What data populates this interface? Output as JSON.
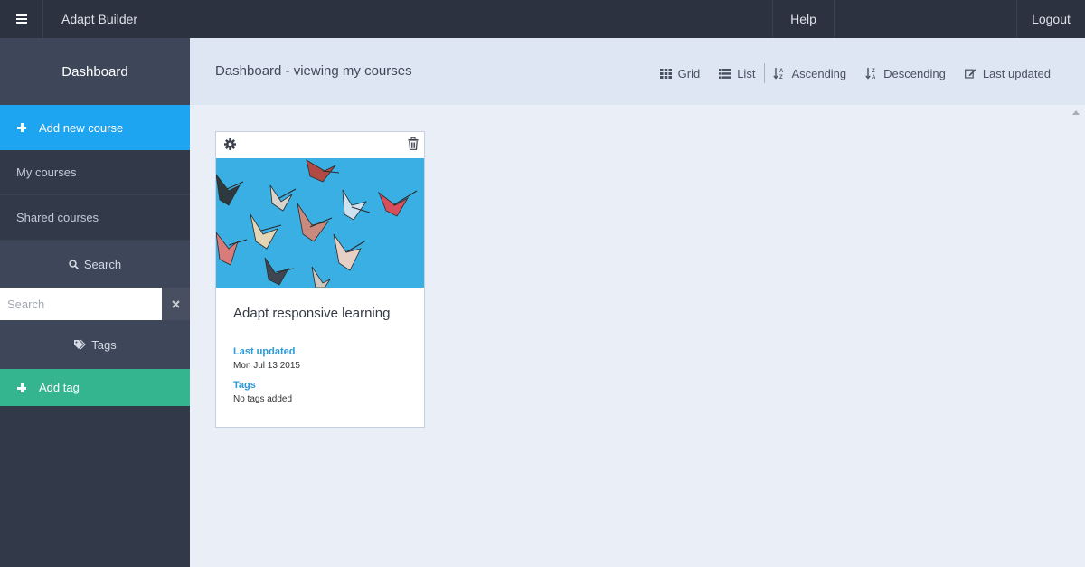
{
  "topbar": {
    "menu_icon": "hamburger-icon",
    "app_title": "Adapt Builder",
    "help_label": "Help",
    "logout_label": "Logout"
  },
  "sidebar": {
    "header": "Dashboard",
    "add_course_label": "Add new course",
    "items": [
      {
        "label": "My courses"
      },
      {
        "label": "Shared courses"
      }
    ],
    "search_section_label": "Search",
    "search_placeholder": "Search",
    "search_value": "",
    "clear_icon": "close-icon",
    "tags_section_label": "Tags",
    "add_tag_label": "Add tag"
  },
  "main": {
    "title": "Dashboard - viewing my courses",
    "toolbar": {
      "grid_label": "Grid",
      "list_label": "List",
      "ascending_label": "Ascending",
      "descending_label": "Descending",
      "last_updated_label": "Last updated"
    }
  },
  "courses": [
    {
      "title": "Adapt responsive learning",
      "last_updated_label": "Last updated",
      "last_updated_value": "Mon Jul 13 2015",
      "tags_label": "Tags",
      "tags_value": "No tags added",
      "image": "origami-paper-cranes-on-blue"
    }
  ],
  "colors": {
    "topbar": "#2d3241",
    "sidebar": "#323a4a",
    "add_course": "#1ea5f2",
    "add_tag": "#34b58f",
    "accent_text": "#2a9ad8",
    "main_bg": "#e9eef7"
  }
}
